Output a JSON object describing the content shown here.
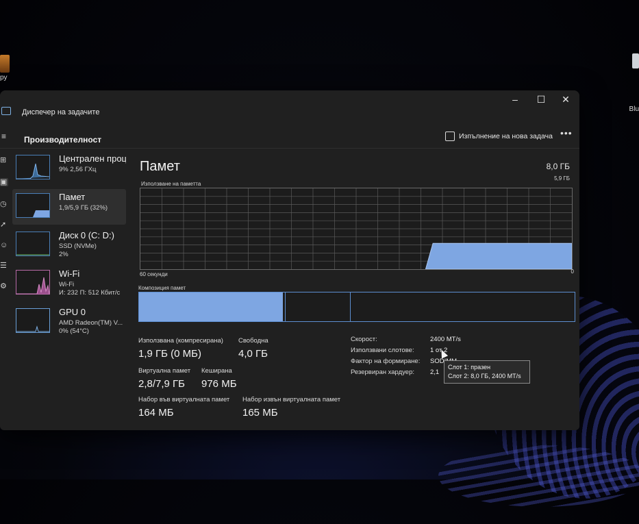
{
  "desktop": {
    "left_label": "py",
    "right_label": "Blu"
  },
  "window": {
    "title": "Диспечер на задачите",
    "controls": {
      "minimize": "–",
      "maximize": "☐",
      "close": "✕"
    }
  },
  "commandbar": {
    "page_title": "Производителност",
    "run_new_task": "Изпълнение на нова задача",
    "more": "•••"
  },
  "sidebar": {
    "items": [
      {
        "name": "Централен проце",
        "sub1": "9% 2,56 ГХц",
        "sub2": ""
      },
      {
        "name": "Памет",
        "sub1": "1,9/5,9 ГБ (32%)",
        "sub2": ""
      },
      {
        "name": "Диск 0 (C: D:)",
        "sub1": "SSD (NVMe)",
        "sub2": "2%"
      },
      {
        "name": "Wi-Fi",
        "sub1": "Wi-Fi",
        "sub2": "И: 232 П: 512 Кбит/с"
      },
      {
        "name": "GPU 0",
        "sub1": "AMD Radeon(TM) V...",
        "sub2": "0% (54°C)"
      }
    ]
  },
  "memory": {
    "title": "Памет",
    "total": "8,0 ГБ",
    "usage_label": "Използване на паметта",
    "usage_max": "5,9 ГБ",
    "graph_left": "60 секунди",
    "graph_right": "0",
    "composition_label": "Композиция памет",
    "composition": {
      "used_fraction": 0.33,
      "modified_fraction": 0.005,
      "standby_fraction": 0.15
    },
    "usage_history": [
      0,
      0,
      0,
      0,
      0,
      0,
      0,
      0,
      0,
      0,
      0,
      0,
      0,
      0,
      0,
      0,
      0,
      0,
      0,
      0,
      0,
      0,
      0,
      0,
      0,
      0,
      0,
      0,
      0,
      0,
      0,
      0,
      0,
      0,
      0,
      0,
      0,
      0,
      0,
      0,
      0.32,
      0.32,
      0.32,
      0.32,
      0.32,
      0.32,
      0.32,
      0.32,
      0.32,
      0.32,
      0.32,
      0.32,
      0.32,
      0.32,
      0.32,
      0.32,
      0.32,
      0.32,
      0.32,
      0.32
    ]
  },
  "stats": {
    "in_use_label": "Използвана (компресирана)",
    "in_use_value": "1,9 ГБ (0 МБ)",
    "available_label": "Свободна",
    "available_value": "4,0 ГБ",
    "committed_label": "Виртуална памет",
    "committed_value": "2,8/7,9 ГБ",
    "cached_label": "Кеширана",
    "cached_value": "976 МБ",
    "paged_label": "Набор във виртуалната памет",
    "paged_value": "164 МБ",
    "nonpaged_label": "Набор извън виртуалната памет",
    "nonpaged_value": "165 МБ"
  },
  "details": {
    "speed_label": "Скорост:",
    "speed_value": "2400 MT/s",
    "slots_label": "Използвани слотове:",
    "slots_value": "1 от 2",
    "form_label": "Фактор на формиране:",
    "form_value": "SODIMM",
    "reserved_label": "Резервиран хардуер:",
    "reserved_value": "2,1"
  },
  "tooltip": {
    "line1": "Слот 1: празен",
    "line2": "Слот 2: 8,0 ГБ, 2400 MT/s"
  },
  "colors": {
    "accent": "#7ea6e2",
    "window_bg": "#202020",
    "grid": "#5a5a5a"
  }
}
